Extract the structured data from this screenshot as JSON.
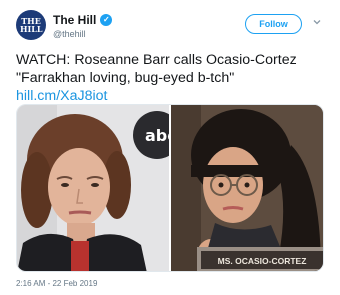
{
  "account": {
    "avatar_text": "THE HILL",
    "display_name": "The Hill",
    "handle": "@thehill",
    "verified_icon": "verified-badge-icon"
  },
  "actions": {
    "follow_label": "Follow",
    "menu_icon": "chevron-down-icon"
  },
  "tweet": {
    "line1": "WATCH: Roseanne Barr calls Ocasio-Cortez",
    "line2": "\"Farrakhan loving, bug-eyed b-tch\"",
    "link": "hill.cm/XaJ8iot"
  },
  "media": {
    "left_backdrop_text": "abc",
    "nameplate_text": "MS. OCASIO-CORTEZ"
  },
  "timestamp": "2:16 AM - 22 Feb 2019",
  "colors": {
    "accent": "#1da1f2",
    "link": "#1b95e0",
    "text": "#14171a",
    "muted": "#657786"
  }
}
